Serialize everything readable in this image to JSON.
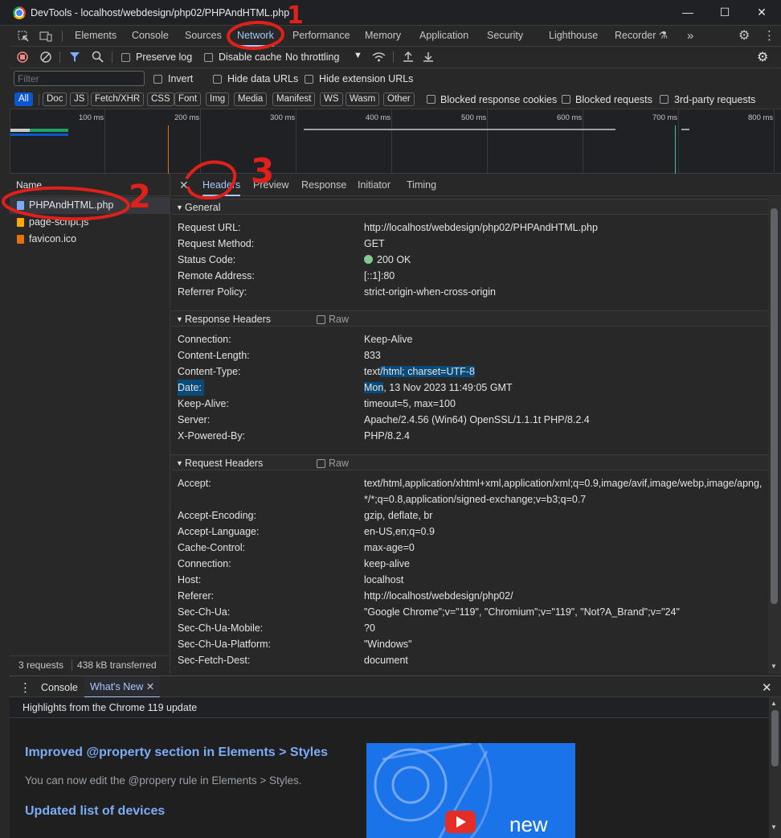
{
  "window": {
    "title": "DevTools - localhost/webdesign/php02/PHPAndHTML.php"
  },
  "main_tabs": [
    "Elements",
    "Console",
    "Sources",
    "Network",
    "Performance",
    "Memory",
    "Application",
    "Security",
    "Lighthouse",
    "Recorder"
  ],
  "toolbar": {
    "preserve_log": "Preserve log",
    "disable_cache": "Disable cache",
    "throttling": "No throttling"
  },
  "filter": {
    "placeholder": "Filter",
    "invert": "Invert",
    "hide_data_urls": "Hide data URLs",
    "hide_extension_urls": "Hide extension URLs"
  },
  "type_filters": [
    "All",
    "Doc",
    "JS",
    "Fetch/XHR",
    "CSS",
    "Font",
    "Img",
    "Media",
    "Manifest",
    "WS",
    "Wasm",
    "Other"
  ],
  "type_checks": [
    "Blocked response cookies",
    "Blocked requests",
    "3rd-party requests"
  ],
  "timeline_ticks": [
    "100 ms",
    "200 ms",
    "300 ms",
    "400 ms",
    "500 ms",
    "600 ms",
    "700 ms",
    "800 ms"
  ],
  "requests": {
    "column": "Name",
    "items": [
      "PHPAndHTML.php",
      "page-script.js",
      "favicon.ico"
    ],
    "status_count": "3 requests",
    "status_transferred": "438 kB transferred"
  },
  "detail_tabs": [
    "Headers",
    "Preview",
    "Response",
    "Initiator",
    "Timing"
  ],
  "general": {
    "title": "General",
    "rows": [
      {
        "k": "Request URL:",
        "v": "http://localhost/webdesign/php02/PHPAndHTML.php"
      },
      {
        "k": "Request Method:",
        "v": "GET"
      },
      {
        "k": "Status Code:",
        "v": "200 OK"
      },
      {
        "k": "Remote Address:",
        "v": "[::1]:80"
      },
      {
        "k": "Referrer Policy:",
        "v": "strict-origin-when-cross-origin"
      }
    ]
  },
  "response_headers": {
    "title": "Response Headers",
    "raw": "Raw",
    "rows": [
      {
        "k": "Connection:",
        "v": "Keep-Alive"
      },
      {
        "k": "Content-Length:",
        "v": "833"
      },
      {
        "k": "Content-Type:",
        "v_pre": "text",
        "v_sel": "/html; charset=UTF-8"
      },
      {
        "k": "Date:",
        "v_sel": "Mon",
        "v_post": ", 13 Nov 2023 11:49:05 GMT"
      },
      {
        "k": "Keep-Alive:",
        "v": "timeout=5, max=100"
      },
      {
        "k": "Server:",
        "v": "Apache/2.4.56 (Win64) OpenSSL/1.1.1t PHP/8.2.4"
      },
      {
        "k": "X-Powered-By:",
        "v": "PHP/8.2.4"
      }
    ]
  },
  "request_headers": {
    "title": "Request Headers",
    "raw": "Raw",
    "rows": [
      {
        "k": "Accept:",
        "v": "text/html,application/xhtml+xml,application/xml;q=0.9,image/avif,image/webp,image/apng,",
        "v2": "*/*;q=0.8,application/signed-exchange;v=b3;q=0.7"
      },
      {
        "k": "Accept-Encoding:",
        "v": "gzip, deflate, br"
      },
      {
        "k": "Accept-Language:",
        "v": "en-US,en;q=0.9"
      },
      {
        "k": "Cache-Control:",
        "v": "max-age=0"
      },
      {
        "k": "Connection:",
        "v": "keep-alive"
      },
      {
        "k": "Host:",
        "v": "localhost"
      },
      {
        "k": "Referer:",
        "v": "http://localhost/webdesign/php02/"
      },
      {
        "k": "Sec-Ch-Ua:",
        "v": "\"Google Chrome\";v=\"119\", \"Chromium\";v=\"119\", \"Not?A_Brand\";v=\"24\""
      },
      {
        "k": "Sec-Ch-Ua-Mobile:",
        "v": "?0"
      },
      {
        "k": "Sec-Ch-Ua-Platform:",
        "v": "\"Windows\""
      },
      {
        "k": "Sec-Fetch-Dest:",
        "v": "document"
      }
    ]
  },
  "drawer": {
    "tabs": [
      "Console",
      "What's New"
    ],
    "header": "Highlights from the Chrome 119 update",
    "item1_title": "Improved @property section in Elements > Styles",
    "item1_desc": "You can now edit the @propery rule in Elements > Styles.",
    "item2_title": "Updated list of devices",
    "banner_text": "new"
  },
  "annotations": {
    "n1": "1",
    "n2": "2",
    "n3": "3"
  },
  "colors": {
    "accent": "#a8c7fa",
    "selection": "#0a4a78",
    "status_ok": "#81c995",
    "annotation": "#e0201a"
  }
}
